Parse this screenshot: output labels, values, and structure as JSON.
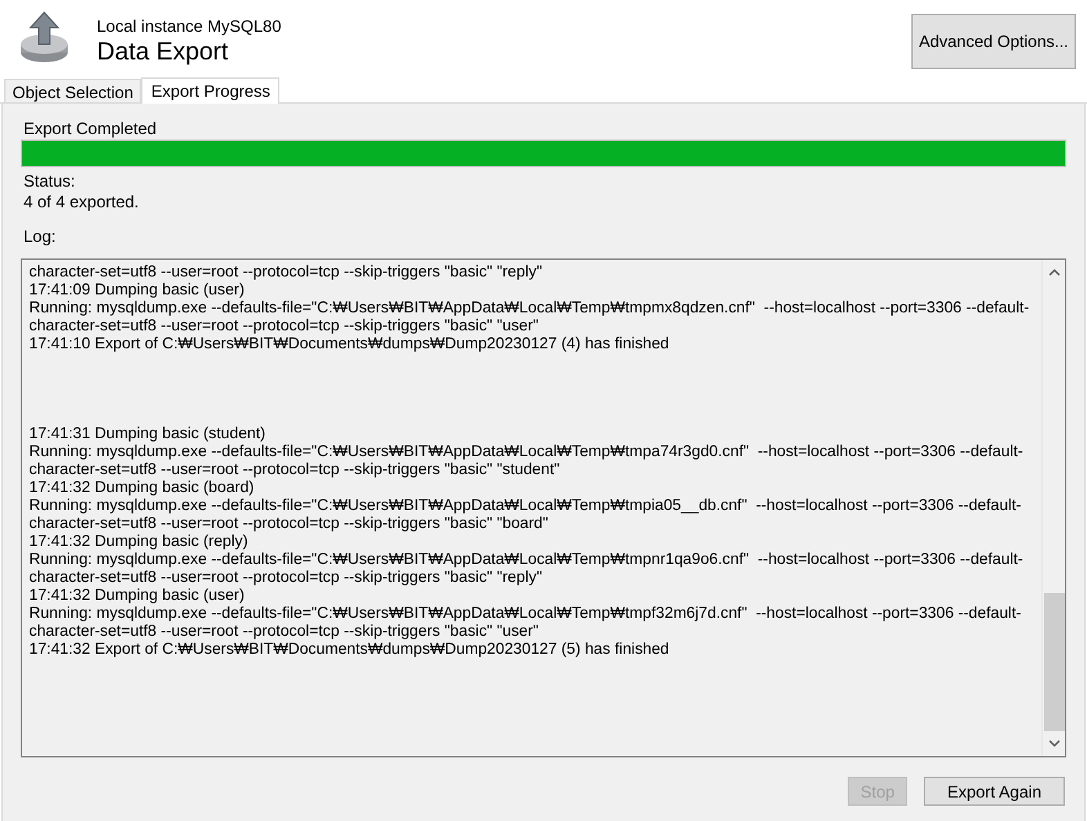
{
  "header": {
    "subtitle": "Local instance MySQL80",
    "title": "Data Export",
    "advanced_button": "Advanced Options..."
  },
  "tabs": [
    {
      "label": "Object Selection",
      "selected": false
    },
    {
      "label": "Export Progress",
      "selected": true
    }
  ],
  "progress": {
    "label": "Export Completed",
    "level": 1
  },
  "status": {
    "label": "Status:",
    "value": "4 of 4 exported."
  },
  "log": {
    "label": "Log:",
    "lines": [
      {
        "kind": "text",
        "text": "character-set=utf8 --user=root --protocol=tcp --skip-triggers \"basic\" \"reply\""
      },
      {
        "kind": "text",
        "text": "17:41:09 Dumping basic (user)"
      },
      {
        "kind": "text",
        "text": "Running: mysqldump.exe --defaults-file=\"C:₩Users₩BIT₩AppData₩Local₩Temp₩tmpmx8qdzen.cnf\"  --host=localhost --port=3306 --default-"
      },
      {
        "kind": "text",
        "text": "character-set=utf8 --user=root --protocol=tcp --skip-triggers \"basic\" \"user\""
      },
      {
        "kind": "text",
        "text": "17:41:10 Export of C:₩Users₩BIT₩Documents₩dumps₩Dump20230127 (4) has finished"
      },
      {
        "kind": "blank"
      },
      {
        "kind": "blank"
      },
      {
        "kind": "blank"
      },
      {
        "kind": "blank"
      },
      {
        "kind": "text",
        "text": "17:41:31 Dumping basic (student)"
      },
      {
        "kind": "text",
        "text": "Running: mysqldump.exe --defaults-file=\"C:₩Users₩BIT₩AppData₩Local₩Temp₩tmpa74r3gd0.cnf\"  --host=localhost --port=3306 --default-"
      },
      {
        "kind": "text",
        "text": "character-set=utf8 --user=root --protocol=tcp --skip-triggers \"basic\" \"student\""
      },
      {
        "kind": "text",
        "text": "17:41:32 Dumping basic (board)"
      },
      {
        "kind": "text",
        "text": "Running: mysqldump.exe --defaults-file=\"C:₩Users₩BIT₩AppData₩Local₩Temp₩tmpia05__db.cnf\"  --host=localhost --port=3306 --default-"
      },
      {
        "kind": "text",
        "text": "character-set=utf8 --user=root --protocol=tcp --skip-triggers \"basic\" \"board\""
      },
      {
        "kind": "text",
        "text": "17:41:32 Dumping basic (reply)"
      },
      {
        "kind": "text",
        "text": "Running: mysqldump.exe --defaults-file=\"C:₩Users₩BIT₩AppData₩Local₩Temp₩tmpnr1qa9o6.cnf\"  --host=localhost --port=3306 --default-"
      },
      {
        "kind": "text",
        "text": "character-set=utf8 --user=root --protocol=tcp --skip-triggers \"basic\" \"reply\""
      },
      {
        "kind": "text",
        "text": "17:41:32 Dumping basic (user)"
      },
      {
        "kind": "text",
        "text": "Running: mysqldump.exe --defaults-file=\"C:₩Users₩BIT₩AppData₩Local₩Temp₩tmpf32m6j7d.cnf\"  --host=localhost --port=3306 --default-"
      },
      {
        "kind": "text",
        "text": "character-set=utf8 --user=root --protocol=tcp --skip-triggers \"basic\" \"user\""
      },
      {
        "kind": "text",
        "text": "17:41:32 Export of C:₩Users₩BIT₩Documents₩dumps₩Dump20230127 (5) has finished"
      }
    ]
  },
  "buttons": [
    {
      "label": "Stop",
      "disabled": true
    },
    {
      "label": "Export Again",
      "disabled": false
    }
  ]
}
